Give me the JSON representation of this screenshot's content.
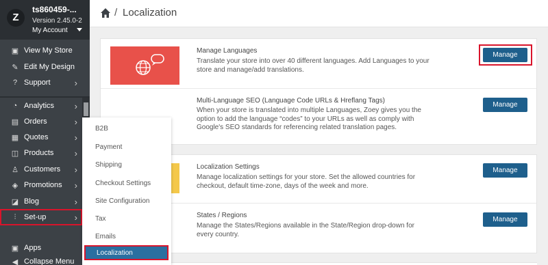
{
  "sidebar": {
    "store_name": "ts860459-...",
    "version": "Version 2.45.0-2",
    "account": "My Account",
    "logo_letter": "Z",
    "items": [
      {
        "label": "View My Store",
        "icon": "store-icon",
        "glyph": "▣"
      },
      {
        "label": "Edit My Design",
        "icon": "pencil-icon",
        "glyph": "✎"
      },
      {
        "label": "Support",
        "icon": "help-icon",
        "glyph": "?"
      },
      {
        "label": "Analytics",
        "icon": "pie-chart-icon",
        "glyph": "◔"
      },
      {
        "label": "Orders",
        "icon": "orders-icon",
        "glyph": "▤"
      },
      {
        "label": "Quotes",
        "icon": "quotes-icon",
        "glyph": "▦"
      },
      {
        "label": "Products",
        "icon": "box-icon",
        "glyph": "◫"
      },
      {
        "label": "Customers",
        "icon": "user-icon",
        "glyph": "♙"
      },
      {
        "label": "Promotions",
        "icon": "tag-icon",
        "glyph": "◈"
      },
      {
        "label": "Blog",
        "icon": "blog-icon",
        "glyph": "◪"
      },
      {
        "label": "Set-up",
        "icon": "sliders-icon",
        "glyph": "⫶"
      },
      {
        "label": "Apps",
        "icon": "apps-icon",
        "glyph": "▣"
      },
      {
        "label": "Collapse Menu",
        "icon": "collapse-icon",
        "glyph": "◀"
      }
    ]
  },
  "header": {
    "title": "Localization",
    "separator": "/"
  },
  "setup_menu": {
    "items": [
      "B2B",
      "Payment",
      "Shipping",
      "Checkout Settings",
      "Site Configuration",
      "Tax",
      "Emails"
    ],
    "active": "Localization"
  },
  "cards": {
    "languages": {
      "title": "Manage Languages",
      "desc": "Translate your store into over 40 different languages. Add Languages to your store and manage/add translations.",
      "button": "Manage"
    },
    "seo": {
      "title": "Multi-Language SEO (Language Code URLs & Hreflang Tags)",
      "desc": "When your store is translated into multiple Languages, Zoey gives you the option to add the language “codes” to your URLs as well as comply with Google's SEO standards for referencing related translation pages.",
      "button": "Manage"
    },
    "settings": {
      "title": "Localization Settings",
      "desc": "Manage localization settings for your store. Set the allowed countries for checkout, default time-zone, days of the week and more.",
      "button": "Manage"
    },
    "regions": {
      "title": "States / Regions",
      "desc": "Manage the States/Regions available in the State/Region drop-down for every country.",
      "button": "Manage"
    }
  },
  "colors": {
    "accent": "#1e5f8c",
    "highlight": "#d9142b",
    "banner": "#e8514a",
    "banner2": "#f4c84a"
  }
}
